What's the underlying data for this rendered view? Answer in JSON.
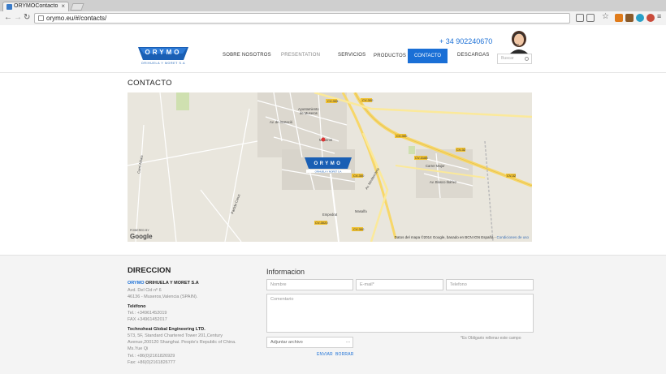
{
  "browser": {
    "tab_title": "ORYMOContacto",
    "url": "orymo.eu/#/contacts/"
  },
  "header": {
    "phone": "+ 34 902240670",
    "nav": [
      "SOBRE NOSOTROS",
      "PRESENTATION",
      "SERVICIOS",
      "PRODUCTOS",
      "CONTACTO",
      "DESCARGAS"
    ],
    "search_placeholder": "Buscar",
    "logo_text": "ORYMO",
    "logo_sub": "ORIHUELA Y MORET S.A"
  },
  "page_title": "CONTACTO",
  "map": {
    "credit": "Datos del mapa ©2014 Google, basado en BCN IGN España",
    "terms": "Condiciones de uso",
    "google_label": "Google",
    "powered": "POWERED BY",
    "labels": [
      "Museros",
      "Empedrat",
      "Masalfa",
      "CV-300",
      "CV-3020",
      "CV-3188",
      "CV-305",
      "CV-301",
      "Av. Blasco Ibáñez",
      "Carrer Major",
      "Camí Aldaia",
      "Partida Creus",
      "Ayuntamiento de Museros",
      "Carrer Montcada",
      "Av. de l'Estació",
      "Av. Mediterrània"
    ]
  },
  "direccion": {
    "title": "DIRECCION",
    "company_brand": "ORYMO",
    "company": "ORIHUELA Y MORET S.A",
    "addr1": "Avd. Del Cid nº 6",
    "addr2": "46136 - Museros,Valencia (SPAIN).",
    "phone_label": "Teléfono",
    "tel": "Tel.: +34961452019",
    "fax": "FAX +34961452017",
    "company2": "Technoheat Global Engineering LTD.",
    "addr3": "573, 5F, Standard Chartered Tower 201,Century",
    "addr4": "Avenue,200120 Shanghai. People's Republic of China.",
    "contact": "Ms.Yue Qi",
    "tel2": "Tel.: +86(0)2161826929",
    "fax2": "Fax: +86(0)2161826777"
  },
  "form": {
    "title": "Informacion",
    "name_ph": "Nombre",
    "email_ph": "E-mail*",
    "phone_ph": "Telefono",
    "comment_ph": "Comentario",
    "attach_label": "Adjuntar archivo",
    "attach_btn": "...",
    "note": "*Es Obligario rellenar este campo",
    "send": "ENVIAR",
    "clear": "BORRAR"
  }
}
